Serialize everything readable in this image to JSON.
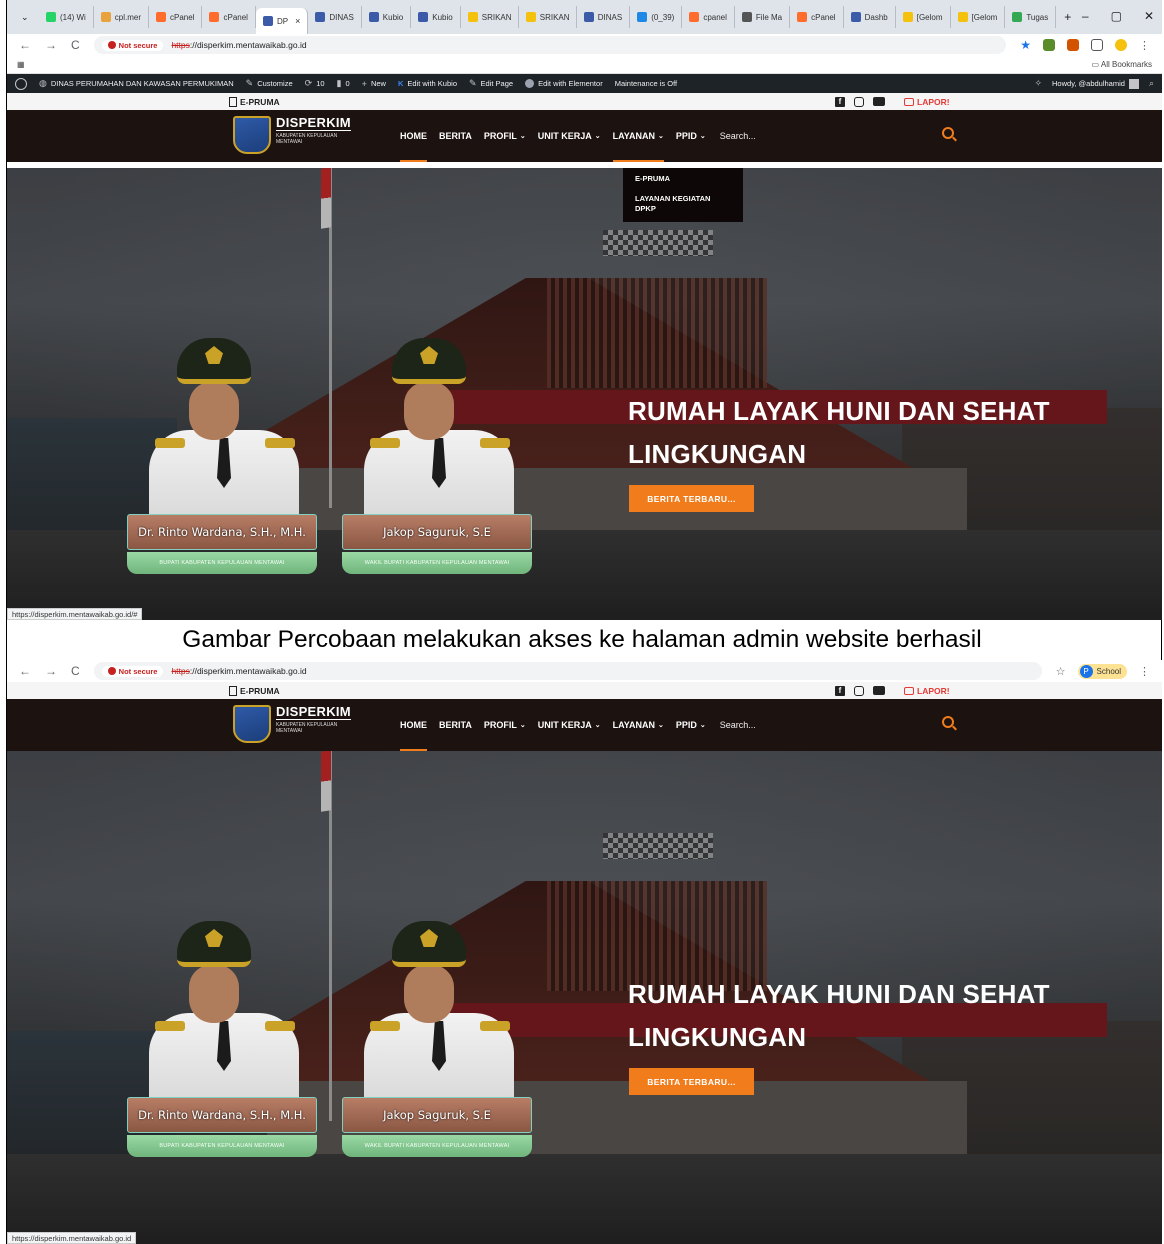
{
  "caption": "Gambar Percobaan melakukan akses ke halaman admin website berhasil",
  "browser": {
    "tabs": [
      {
        "label": "(14) Wi",
        "color": "#25d366"
      },
      {
        "label": "cpl.mer",
        "color": "#e8a33d"
      },
      {
        "label": "cPanel",
        "color": "#ff6c2c"
      },
      {
        "label": "cPanel",
        "color": "#ff6c2c"
      },
      {
        "label": "DP",
        "color": "#3b5ba9",
        "active": true
      },
      {
        "label": "DINAS",
        "color": "#3b5ba9"
      },
      {
        "label": "Kubio",
        "color": "#3b5ba9"
      },
      {
        "label": "Kubio",
        "color": "#3b5ba9"
      },
      {
        "label": "SRIKAN",
        "color": "#f4c20d"
      },
      {
        "label": "SRIKAN",
        "color": "#f4c20d"
      },
      {
        "label": "DINAS",
        "color": "#3b5ba9"
      },
      {
        "label": "(0_39)",
        "color": "#1e88e5"
      },
      {
        "label": "cpanel",
        "color": "#ff6c2c"
      },
      {
        "label": "File Ma",
        "color": "#555555"
      },
      {
        "label": "cPanel",
        "color": "#ff6c2c"
      },
      {
        "label": "Dashb",
        "color": "#3b5ba9"
      },
      {
        "label": "[Gelom",
        "color": "#f4c20d"
      },
      {
        "label": "[Gelom",
        "color": "#f4c20d"
      },
      {
        "label": "Tugas",
        "color": "#34a853"
      }
    ],
    "tab_close": "×",
    "new_tab": "+",
    "window_controls": {
      "minimize": "–",
      "restore": "▢",
      "close": "✕"
    },
    "nav": {
      "back": "←",
      "forward": "→",
      "reload": "C"
    },
    "security_label": "Not secure",
    "url_scheme": "https",
    "url_rest": "://disperkim.mentawaikab.go.id",
    "all_bookmarks": "All Bookmarks",
    "profile_label": "School",
    "profile_initial": "P"
  },
  "wp_admin_bar": {
    "site_name": "DINAS PERUMAHAN DAN KAWASAN PERMUKIMAN",
    "customize": "Customize",
    "updates_count": "10",
    "comments_count": "0",
    "new_label": "New",
    "edit_kubio": "Edit with Kubio",
    "edit_page": "Edit Page",
    "edit_elementor": "Edit with Elementor",
    "maintenance": "Maintenance is Off",
    "howdy": "Howdy, @abdulhamid"
  },
  "site": {
    "topbar_link": "E-PRUMA",
    "lapor": "LAPOR!",
    "logo_title": "DISPERKIM",
    "logo_subtitle": "KABUPATEN KEPULAUAN MENTAWAI",
    "menu": [
      {
        "label": "HOME",
        "dropdown": false
      },
      {
        "label": "BERITA",
        "dropdown": false
      },
      {
        "label": "PROFIL",
        "dropdown": true
      },
      {
        "label": "UNIT KERJA",
        "dropdown": true
      },
      {
        "label": "LAYANAN",
        "dropdown": true
      },
      {
        "label": "PPID",
        "dropdown": true
      }
    ],
    "search_placeholder": "Search...",
    "chevron": "⌄",
    "layanan_dropdown": [
      "E-PRUMA",
      "LAYANAN KEGIATAN DPKP"
    ],
    "hero_title": "RUMAH LAYAK HUNI DAN SEHAT LINGKUNGAN",
    "hero_button": "BERITA TERBARU...",
    "officials": [
      {
        "name": "Dr. Rinto Wardana, S.H., M.H.",
        "role": "BUPATI KABUPATEN KEPULAUAN MENTAWAI"
      },
      {
        "name": "Jakop Saguruk, S.E",
        "role": "WAKIL BUPATI KABUPATEN KEPULAUAN MENTAWAI"
      }
    ]
  },
  "status_url_1": "https://disperkim.mentawaikab.go.id/#",
  "status_url_2": "https://disperkim.mentawaikab.go.id"
}
